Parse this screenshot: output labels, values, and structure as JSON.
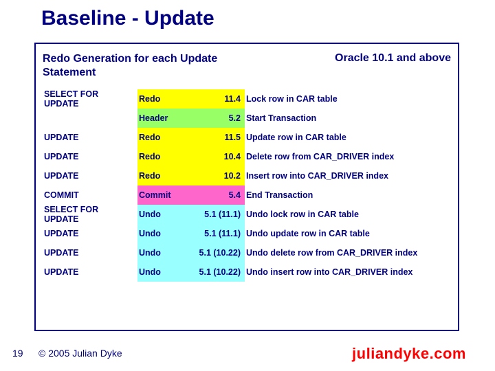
{
  "title": "Baseline - Update",
  "header_left": "Redo Generation for each Update Statement",
  "header_right": "Oracle 10.1 and above",
  "rows": [
    {
      "c0": "SELECT FOR UPDATE",
      "c1": "Redo",
      "c2": "11.4",
      "c3": "Lock row in CAR table",
      "color": "bg-yellow"
    },
    {
      "c0": "",
      "c1": "Header",
      "c2": "5.2",
      "c3": "Start Transaction",
      "color": "bg-green"
    },
    {
      "c0": "UPDATE",
      "c1": "Redo",
      "c2": "11.5",
      "c3": "Update row in CAR table",
      "color": "bg-yellow"
    },
    {
      "c0": "UPDATE",
      "c1": "Redo",
      "c2": "10.4",
      "c3": "Delete row from CAR_DRIVER index",
      "color": "bg-yellow"
    },
    {
      "c0": "UPDATE",
      "c1": "Redo",
      "c2": "10.2",
      "c3": "Insert row into CAR_DRIVER index",
      "color": "bg-yellow"
    },
    {
      "c0": "COMMIT",
      "c1": "Commit",
      "c2": "5.4",
      "c3": "End Transaction",
      "color": "bg-magenta"
    },
    {
      "c0": "SELECT FOR UPDATE",
      "c1": "Undo",
      "c2": "5.1 (11.1)",
      "c3": "Undo lock row in CAR table",
      "color": "bg-cyan"
    },
    {
      "c0": "UPDATE",
      "c1": "Undo",
      "c2": "5.1 (11.1)",
      "c3": "Undo update row in CAR table",
      "color": "bg-cyan"
    },
    {
      "c0": "UPDATE",
      "c1": "Undo",
      "c2": "5.1 (10.22)",
      "c3": "Undo delete row from CAR_DRIVER index",
      "color": "bg-cyan"
    },
    {
      "c0": "UPDATE",
      "c1": "Undo",
      "c2": "5.1 (10.22)",
      "c3": "Undo insert row into CAR_DRIVER index",
      "color": "bg-cyan"
    }
  ],
  "footer": {
    "page": "19",
    "copyright": "© 2005 Julian Dyke",
    "site": "juliandyke.com"
  }
}
